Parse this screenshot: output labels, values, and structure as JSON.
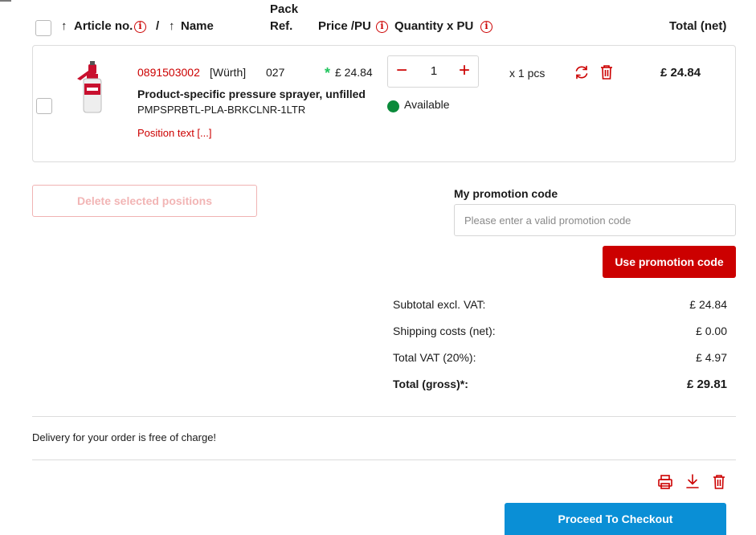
{
  "table_header": {
    "article_no": "Article no.",
    "separator": "/",
    "name": "Name",
    "pack_ref_line1": "Pack",
    "pack_ref_line2": "Ref.",
    "price_pu": "Price /PU",
    "quantity_pu": "Quantity x PU",
    "total_net": "Total (net)",
    "sort_arrow": "↑",
    "info_glyph": "i"
  },
  "item": {
    "article_no": "0891503002",
    "brand": "[Würth]",
    "pack_ref": "027",
    "price_marker": "*",
    "price": "£ 24.84",
    "name": "Product-specific pressure sprayer, unfilled",
    "sku": "PMPSPRBTL-PLA-BRKCLNR-1LTR",
    "position_text": "Position text [...]",
    "quantity": "1",
    "unit": "x 1 pcs",
    "availability": "Available",
    "total": "£ 24.84"
  },
  "actions": {
    "delete_selected": "Delete selected positions",
    "promo_title": "My promotion code",
    "promo_placeholder": "Please enter a valid promotion code",
    "use_promo": "Use promotion code",
    "proceed_checkout": "Proceed To Checkout"
  },
  "summary": {
    "subtotal_label": "Subtotal excl. VAT:",
    "subtotal_value": "£ 24.84",
    "shipping_label": "Shipping costs (net):",
    "shipping_value": "£ 0.00",
    "vat_label": "Total VAT (20%):",
    "vat_value": "£ 4.97",
    "gross_label": "Total (gross)",
    "gross_suffix": "*:",
    "gross_value": "£ 29.81"
  },
  "delivery_note": "Delivery for your order is free of charge!",
  "colors": {
    "accent_red": "#cc0000",
    "available_green": "#0a8a3a",
    "checkout_blue": "#0a8fd6"
  },
  "icons": [
    "info-icon",
    "minus-icon",
    "plus-icon",
    "refresh-icon",
    "trash-icon",
    "print-icon",
    "download-icon",
    "sort-arrow-icon"
  ]
}
